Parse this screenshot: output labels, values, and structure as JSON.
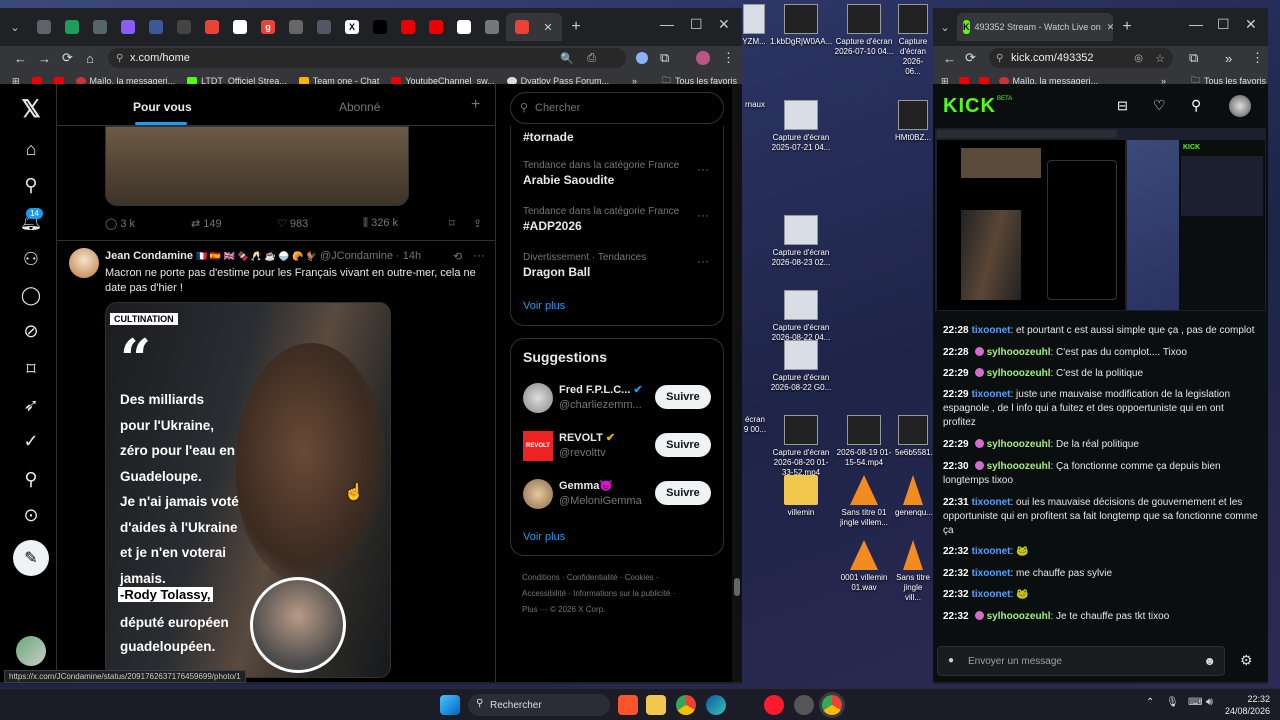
{
  "left_window": {
    "tabs": [
      "",
      "",
      "",
      "",
      "",
      "",
      "",
      "",
      "g",
      "",
      "",
      "X",
      "",
      "",
      "",
      "",
      "",
      ""
    ],
    "url": "x.com/home",
    "bookmarks": [
      "",
      "Maïlo, la messageri...",
      "LTDT_Officiel Strea...",
      "Team one - Chat",
      "YoutubeChannel_sw...",
      "Dyatlov Pass Forum..."
    ],
    "bookmarks_all": "Tous les favoris",
    "status_url": "https://x.com/JCondamine/status/2091762637176459699/photo/1"
  },
  "x": {
    "tabs": [
      "Pour vous",
      "Abonné"
    ],
    "notif_count": "14",
    "prev_post_stats": {
      "replies": "3 k",
      "reposts": "149",
      "likes": "983",
      "views": "326 k"
    },
    "post": {
      "author": "Jean Condamine",
      "flags": "🇫🇷 🇪🇸 🇬🇧 🍫 🥂 ☕ 🍚 🥐 🐓",
      "handle": "@JCondamine · 14h",
      "text": "Macron ne porte pas d'estime pour les Français vivant en outre-mer, cela ne date pas d'hier !",
      "image_tag": "CULTINATION",
      "image_quote_mark": "“",
      "image_lines": [
        "Des milliards",
        "pour l'Ukraine,",
        "zéro pour l'eau en",
        "Guadeloupe.",
        "Je n'ai jamais voté",
        "d'aides à l'Ukraine",
        "et je n'en voterai",
        "jamais."
      ],
      "image_name": "-Rody Tolassy,",
      "image_role": [
        "député européen",
        "guadeloupéen."
      ]
    },
    "search_placeholder": "Chercher",
    "trends": [
      {
        "cat": "",
        "name": "#tornade"
      },
      {
        "cat": "Tendance dans la catégorie France",
        "name": "Arabie Saoudite"
      },
      {
        "cat": "Tendance dans la catégorie France",
        "name": "#ADP2026"
      },
      {
        "cat": "Divertissement · Tendances",
        "name": "Dragon Ball"
      }
    ],
    "trends_more": "Voir plus",
    "suggestions_title": "Suggestions",
    "suggestions": [
      {
        "name": "Fred F.P.L.C...",
        "handle": "@charliezemm...",
        "btn": "Suivre"
      },
      {
        "name": "REVOLT",
        "handle": "@revolttv",
        "btn": "Suivre",
        "logo": "REVOLT"
      },
      {
        "name": "Gemma😈",
        "handle": "@MeloniGemma",
        "btn": "Suivre"
      }
    ],
    "suggestions_more": "Voir plus",
    "footer": [
      "Conditions",
      "Confidentialité",
      "Cookies",
      "Accessibilité",
      "Informations sur la publicité",
      "Plus ···",
      "© 2026 X Corp."
    ]
  },
  "right_window": {
    "tab_title": "493352 Stream - Watch Live on",
    "url": "kick.com/493352",
    "bookmark": "Maïlo, la messageri...",
    "bookmarks_all": "Tous les favoris"
  },
  "kick": {
    "logo": "KICK",
    "logo_beta": "BETA",
    "chat": [
      {
        "time": "22:28",
        "user": "tixoonet",
        "c": "u1",
        "badge": false,
        "msg": "et pourtant c est aussi simple que ça , pas de complot"
      },
      {
        "time": "22:28",
        "user": "sylhooozeuhl",
        "c": "u2",
        "badge": true,
        "msg": "C'est pas du complot.... Tixoo"
      },
      {
        "time": "22:29",
        "user": "sylhooozeuhl",
        "c": "u2",
        "badge": true,
        "msg": "C'est de la politique"
      },
      {
        "time": "22:29",
        "user": "tixoonet",
        "c": "u1",
        "badge": false,
        "msg": "juste une mauvaise modification de la legislation espagnole , de l info qui a fuitez et des oppoertuniste qui en ont profitez"
      },
      {
        "time": "22:29",
        "user": "sylhooozeuhl",
        "c": "u2",
        "badge": true,
        "msg": "De la réal politique"
      },
      {
        "time": "22:30",
        "user": "sylhooozeuhl",
        "c": "u2",
        "badge": true,
        "msg": "Ça fonctionne comme ça depuis bien longtemps tixoo"
      },
      {
        "time": "22:31",
        "user": "tixoonet",
        "c": "u1",
        "badge": false,
        "msg": "oui les mauvaise décisions de gouvernement et les opportuniste qui en profitent sa fait longtemp que sa fonctionne comme ça"
      },
      {
        "time": "22:32",
        "user": "tixoonet",
        "c": "u1",
        "badge": false,
        "msg": "🐸"
      },
      {
        "time": "22:32",
        "user": "tixoonet",
        "c": "u1",
        "badge": false,
        "msg": "me chauffe pas sylvie"
      },
      {
        "time": "22:32",
        "user": "tixoonet",
        "c": "u1",
        "badge": false,
        "msg": "🐸"
      },
      {
        "time": "22:32",
        "user": "sylhooozeuhl",
        "c": "u2",
        "badge": true,
        "msg": "Je te chauffe pas tkt tixoo"
      }
    ],
    "input_placeholder": "Envoyer un message"
  },
  "desktop_icons": [
    "Capture d'écran 2026-07-10 04...",
    "Capture d'écran 2026-06...",
    "Capture d'écran 2025-07-21 04...",
    "HMt0BZ...",
    "Capture d'écran 2026-08-23 02...",
    "Capture d'écran 2026-08-22 04...",
    "Capture d'écran 2026-08-22 G0...",
    "Capture d'écran 2026-08-20 01-33-52.mp4",
    "2026-08-19 01-15-54.mp4",
    "5e6b5581...",
    "villemin",
    "Sans titre 01 jingle villem...",
    "genenqu...",
    "0001 villemin 01.wav",
    "Sans titre jingle vill..."
  ],
  "taskbar": {
    "search": "Rechercher",
    "time": "22:32",
    "date": "24/08/2026"
  }
}
